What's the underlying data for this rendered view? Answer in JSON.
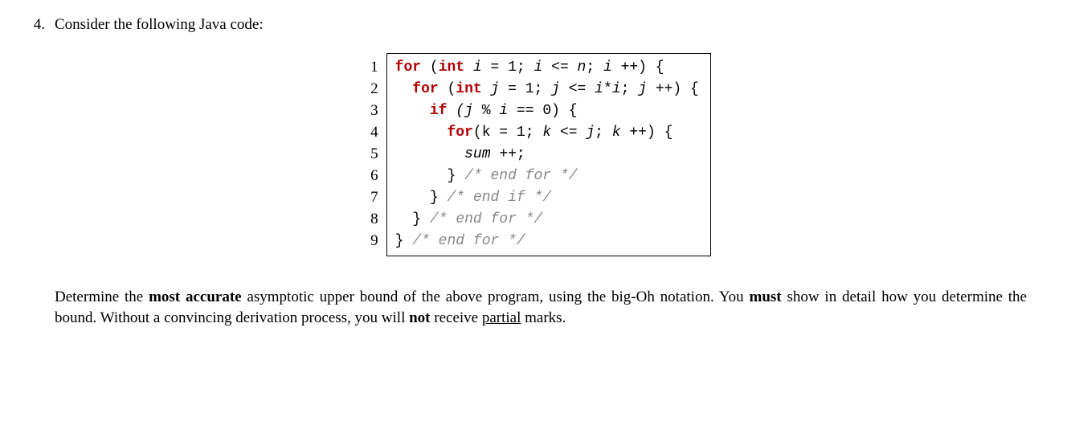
{
  "problem": {
    "number": "4.",
    "intro": "Consider the following Java code:"
  },
  "code": {
    "line_numbers": [
      "1",
      "2",
      "3",
      "4",
      "5",
      "6",
      "7",
      "8",
      "9"
    ],
    "lines": {
      "l1": {
        "kw1": "for",
        "t1": " (",
        "kw2": "int",
        "t2": " i ",
        "s1": "=",
        "t3": " ",
        "s2": "1;",
        "t4": " i ",
        "s3": "<=",
        "t5": " n",
        "s4": ";",
        "t6": " i ",
        "s5": "++) {"
      },
      "l2": {
        "pre": "  ",
        "kw1": "for",
        "t1": " (",
        "kw2": "int",
        "t2": " j ",
        "s1": "=",
        "t3": " ",
        "s2": "1;",
        "t4": " j ",
        "s3": "<=",
        "t5": " i",
        "s4": "*",
        "t6": "i",
        "s5": ";",
        "t7": " j ",
        "s6": "++) {"
      },
      "l3": {
        "pre": "    ",
        "kw1": "if",
        "t1": " (j ",
        "s1": "%",
        "t2": " i ",
        "s2": "==",
        "t3": " ",
        "s3": "0) {"
      },
      "l4": {
        "pre": "      ",
        "kw1": "for",
        "t1": "(k ",
        "s1": "=",
        "t2": " ",
        "s2": "1;",
        "t3": " k ",
        "s3": "<=",
        "t4": " j",
        "s4": ";",
        "t5": " k ",
        "s5": "++) {"
      },
      "l5": {
        "pre": "        ",
        "t1": "sum ",
        "s1": "++;"
      },
      "l6": {
        "pre": "      ",
        "s1": "} ",
        "c1": "/* end for */"
      },
      "l7": {
        "pre": "    ",
        "s1": "} ",
        "c1": "/* end if */"
      },
      "l8": {
        "pre": "  ",
        "s1": "} ",
        "c1": "/* end for */"
      },
      "l9": {
        "s1": "} ",
        "c1": "/* end for */"
      }
    }
  },
  "question": {
    "part1": "Determine the ",
    "bold1": "most accurate",
    "part2": " asymptotic upper bound of the above program, using the big-Oh notation. You ",
    "bold2": "must",
    "part3": " show in detail how you determine the bound. Without a convincing derivation process, you will ",
    "bold3": "not",
    "part4": " receive ",
    "underline1": "partial",
    "part5": " marks."
  }
}
